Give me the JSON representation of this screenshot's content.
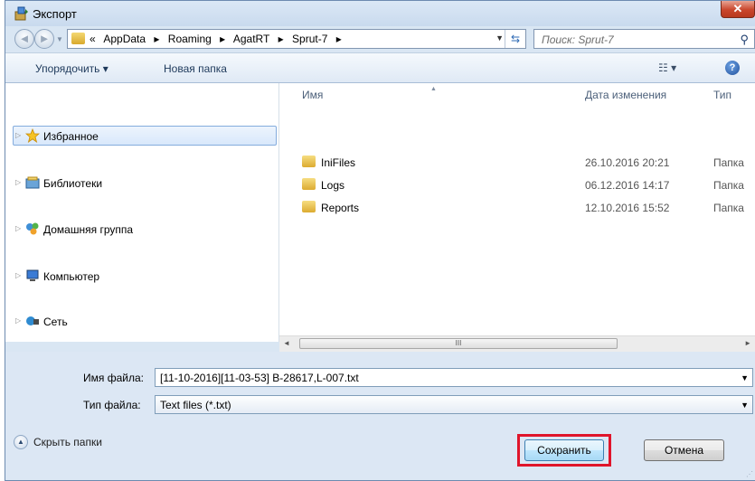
{
  "window": {
    "title": "Экспорт",
    "close_label": "✕"
  },
  "nav": {
    "back_icon": "back-arrow-icon",
    "forward_icon": "forward-arrow-icon",
    "breadcrumb": [
      "«",
      "AppData",
      "▸",
      "Roaming",
      "▸",
      "AgatRT",
      "▸",
      "Sprut-7",
      "▸"
    ],
    "search_placeholder": "Поиск: Sprut-7"
  },
  "toolbar": {
    "organize": "Упорядочить ▾",
    "new_folder": "Новая папка",
    "views": "☷ ▾",
    "help": "?"
  },
  "sidebar": {
    "items": [
      {
        "label": "Избранное",
        "icon": "star-icon",
        "selected": true
      },
      {
        "label": "Библиотеки",
        "icon": "library-icon"
      },
      {
        "label": "Домашняя группа",
        "icon": "homegroup-icon"
      },
      {
        "label": "Компьютер",
        "icon": "computer-icon"
      },
      {
        "label": "Сеть",
        "icon": "network-icon"
      }
    ]
  },
  "filelist": {
    "columns": {
      "name": "Имя",
      "date": "Дата изменения",
      "type": "Тип"
    },
    "rows": [
      {
        "name": "IniFiles",
        "date": "26.10.2016 20:21",
        "type": "Папка"
      },
      {
        "name": "Logs",
        "date": "06.12.2016 14:17",
        "type": "Папка"
      },
      {
        "name": "Reports",
        "date": "12.10.2016 15:52",
        "type": "Папка"
      }
    ],
    "scroll_grip": "III"
  },
  "form": {
    "filename_label": "Имя файла:",
    "filename_value": "[11-10-2016][11-03-53] B-28617,L-007.txt",
    "filetype_label": "Тип файла:",
    "filetype_value": "Text files (*.txt)"
  },
  "footer": {
    "hide_folders": "Скрыть папки",
    "save": "Сохранить",
    "cancel": "Отмена"
  },
  "colors": {
    "highlight": "#e0152b",
    "accent": "#84acdd"
  }
}
